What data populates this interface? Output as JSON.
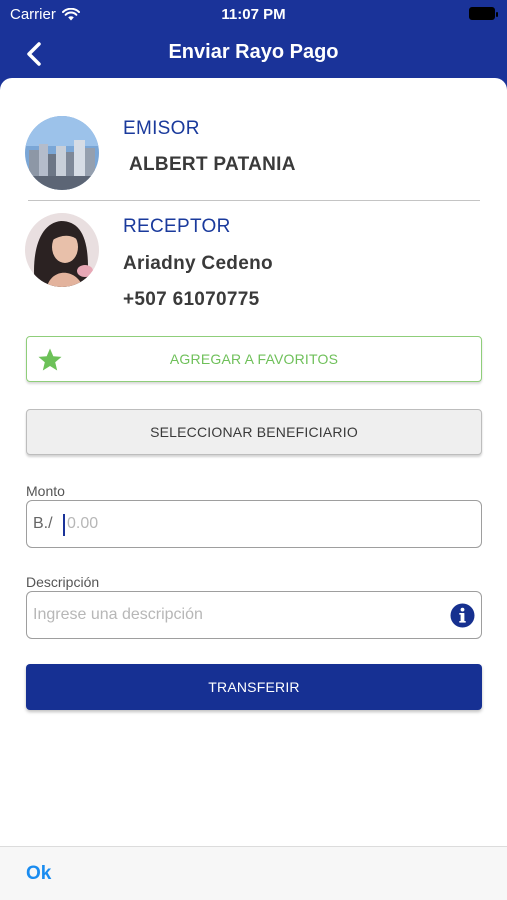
{
  "status_bar": {
    "carrier": "Carrier",
    "time": "11:07 PM"
  },
  "nav": {
    "title": "Enviar Rayo Pago",
    "back_icon": "chevron-left-icon"
  },
  "sender": {
    "label": "EMISOR",
    "name": "ALBERT PATANIA"
  },
  "receiver": {
    "label": "RECEPTOR",
    "name": "Ariadny  Cedeno",
    "phone": "+507 61070775"
  },
  "buttons": {
    "favorites": "AGREGAR A FAVORITOS",
    "select_beneficiary": "SELECCIONAR BENEFICIARIO",
    "transfer": "TRANSFERIR"
  },
  "amount_field": {
    "label": "Monto",
    "prefix": "B./",
    "placeholder": "0.00"
  },
  "description_field": {
    "label": "Descripción",
    "placeholder": "Ingrese una descripción"
  },
  "bottom_bar": {
    "ok": "Ok"
  },
  "colors": {
    "brand": "#1a3399",
    "label_blue": "#1a3a9c",
    "favorite_green": "#6fc05a",
    "ok_blue": "#1a8cf0"
  }
}
